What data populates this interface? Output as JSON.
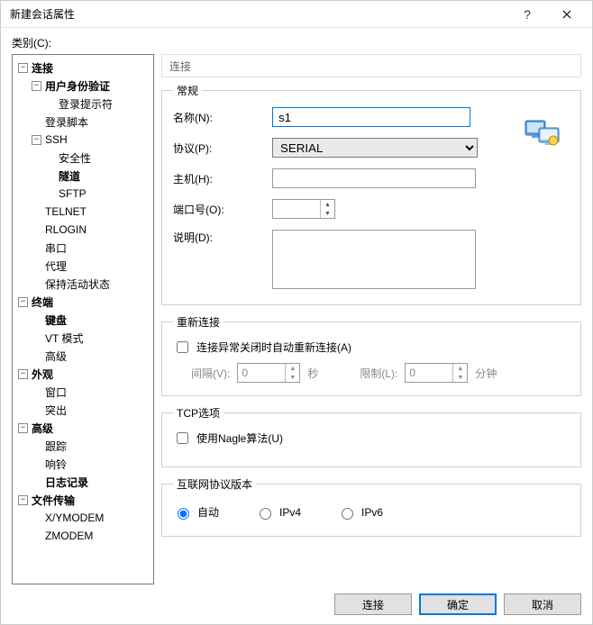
{
  "window": {
    "title": "新建会话属性"
  },
  "category_label": "类别(C):",
  "tree": {
    "connection": "连接",
    "user_auth": "用户身份验证",
    "login_prompt": "登录提示符",
    "login_script": "登录脚本",
    "ssh": "SSH",
    "security": "安全性",
    "tunnel": "隧道",
    "sftp": "SFTP",
    "telnet": "TELNET",
    "rlogin": "RLOGIN",
    "serial": "串口",
    "proxy": "代理",
    "keepalive": "保持活动状态",
    "terminal": "终端",
    "keyboard": "键盘",
    "vt_mode": "VT 模式",
    "advanced_term": "高级",
    "appearance": "外观",
    "window": "窗口",
    "highlight": "突出",
    "advanced": "高级",
    "trace": "跟踪",
    "bell": "响铃",
    "logging": "日志记录",
    "file_transfer": "文件传输",
    "xymodem": "X/YMODEM",
    "zmodem": "ZMODEM"
  },
  "panel_header": "连接",
  "general": {
    "legend": "常规",
    "name_label": "名称(N):",
    "name_value": "s1",
    "protocol_label": "协议(P):",
    "protocol_value": "SERIAL",
    "host_label": "主机(H):",
    "host_value": "",
    "port_label": "端口号(O):",
    "port_value": "",
    "desc_label": "说明(D):",
    "desc_value": ""
  },
  "reconnect": {
    "legend": "重新连接",
    "checkbox_label": "连接异常关闭时自动重新连接(A)",
    "interval_label": "间隔(V):",
    "interval_value": "0",
    "interval_unit": "秒",
    "limit_label": "限制(L):",
    "limit_value": "0",
    "limit_unit": "分钟"
  },
  "tcp": {
    "legend": "TCP选项",
    "nagle_label": "使用Nagle算法(U)"
  },
  "ipver": {
    "legend": "互联网协议版本",
    "auto": "自动",
    "ipv4": "IPv4",
    "ipv6": "IPv6"
  },
  "buttons": {
    "connect": "连接",
    "ok": "确定",
    "cancel": "取消"
  }
}
